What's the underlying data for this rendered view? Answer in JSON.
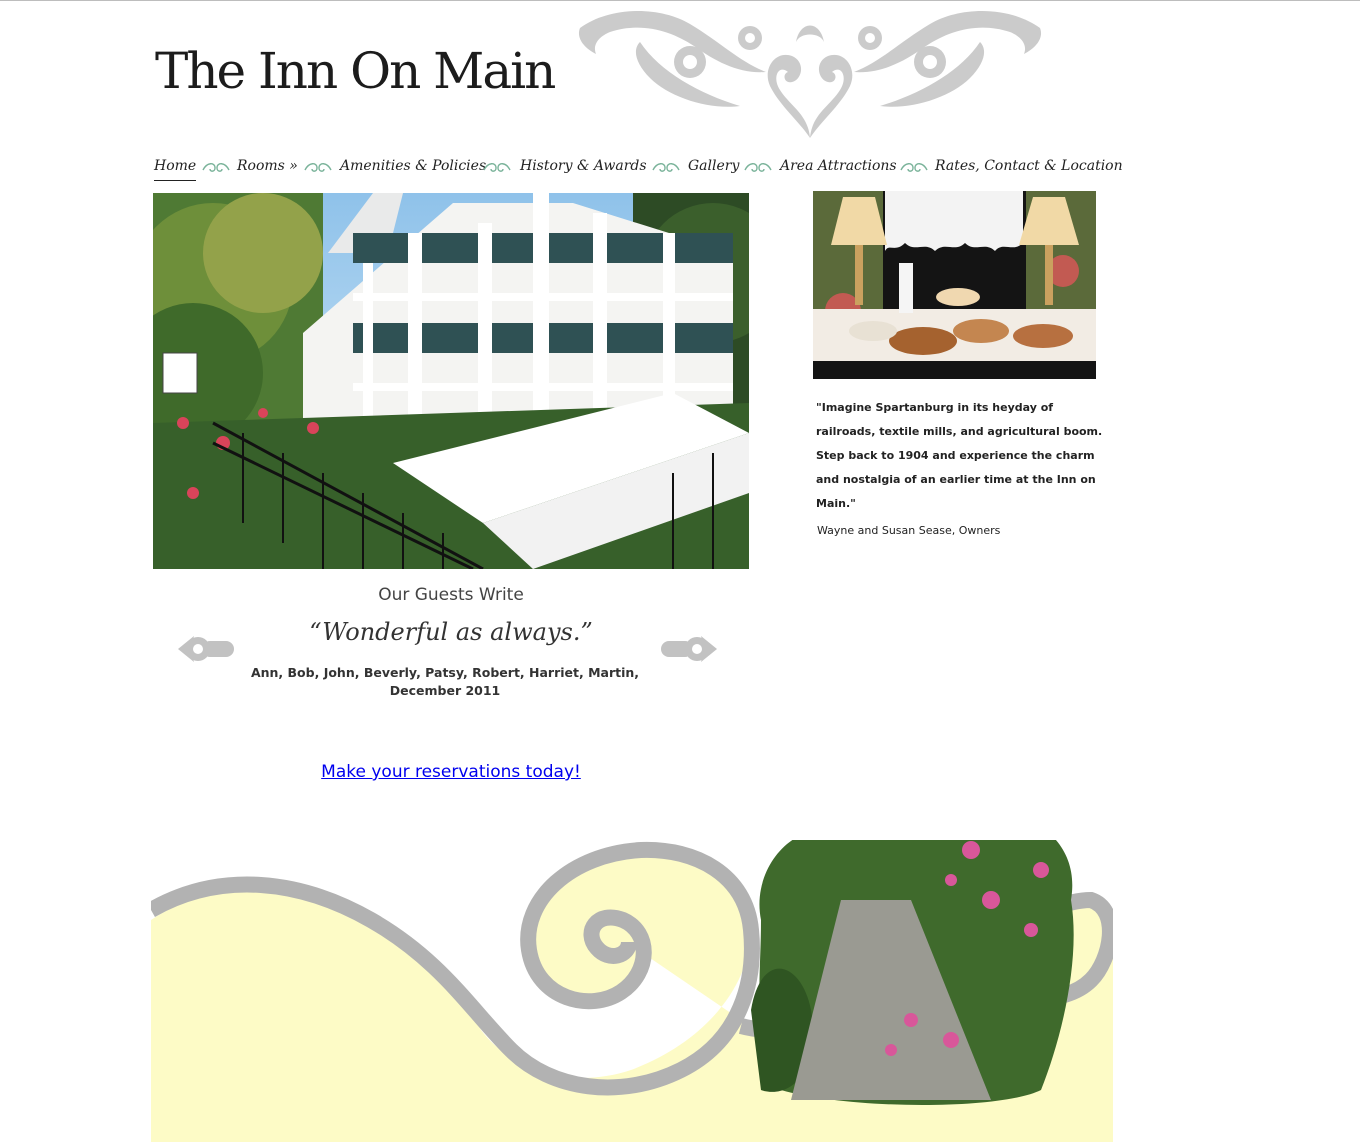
{
  "site": {
    "logo_text": "The Inn On Main"
  },
  "nav": {
    "items": [
      {
        "label": "Home"
      },
      {
        "label": "Rooms »"
      },
      {
        "label": "Amenities & Policies"
      },
      {
        "label": "History & Awards"
      },
      {
        "label": "Gallery"
      },
      {
        "label": "Area Attractions"
      },
      {
        "label": "Rates, Contact & Location"
      }
    ],
    "active": "Home"
  },
  "intro": {
    "quote": "\"Imagine Spartanburg in its heyday of railroads, textile mills, and agricultural boom. Step back to 1904 and experience the charm and nostalgia of an earlier time at the Inn on Main.\"",
    "attribution": "Wayne and Susan Sease, Owners"
  },
  "guests": {
    "title": "Our Guests Write",
    "testimonial": "“Wonderful as always.”",
    "names": "Ann, Bob, John, Beverly, Patsy, Robert, Harriet, Martin, December 2011"
  },
  "cta": {
    "reserve_label": "Make your reservations today!"
  },
  "colors": {
    "accent_flourish": "#c8c8c8",
    "swirl": "#b2b2b2",
    "footer_yellow": "#fdfbc6",
    "link": "#0000ee",
    "nav_divider": "#7ab39a"
  }
}
